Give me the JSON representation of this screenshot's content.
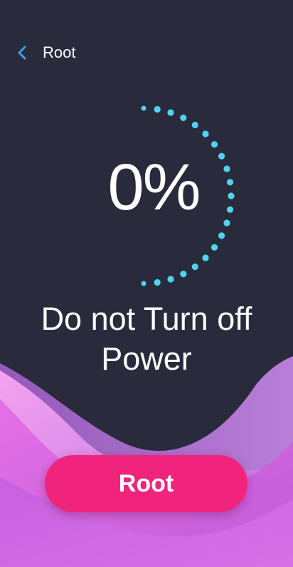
{
  "header": {
    "back_icon": "chevron-left-icon",
    "title": "Root"
  },
  "progress": {
    "percent": 0,
    "label": "0%"
  },
  "message": {
    "line1": "Do not Turn off",
    "line2": "Power"
  },
  "action": {
    "button_label": "Root"
  },
  "colors": {
    "background": "#292b3d",
    "accent": "#4fd3f0",
    "button": "#f0247c",
    "back_icon": "#3aa0e8"
  }
}
